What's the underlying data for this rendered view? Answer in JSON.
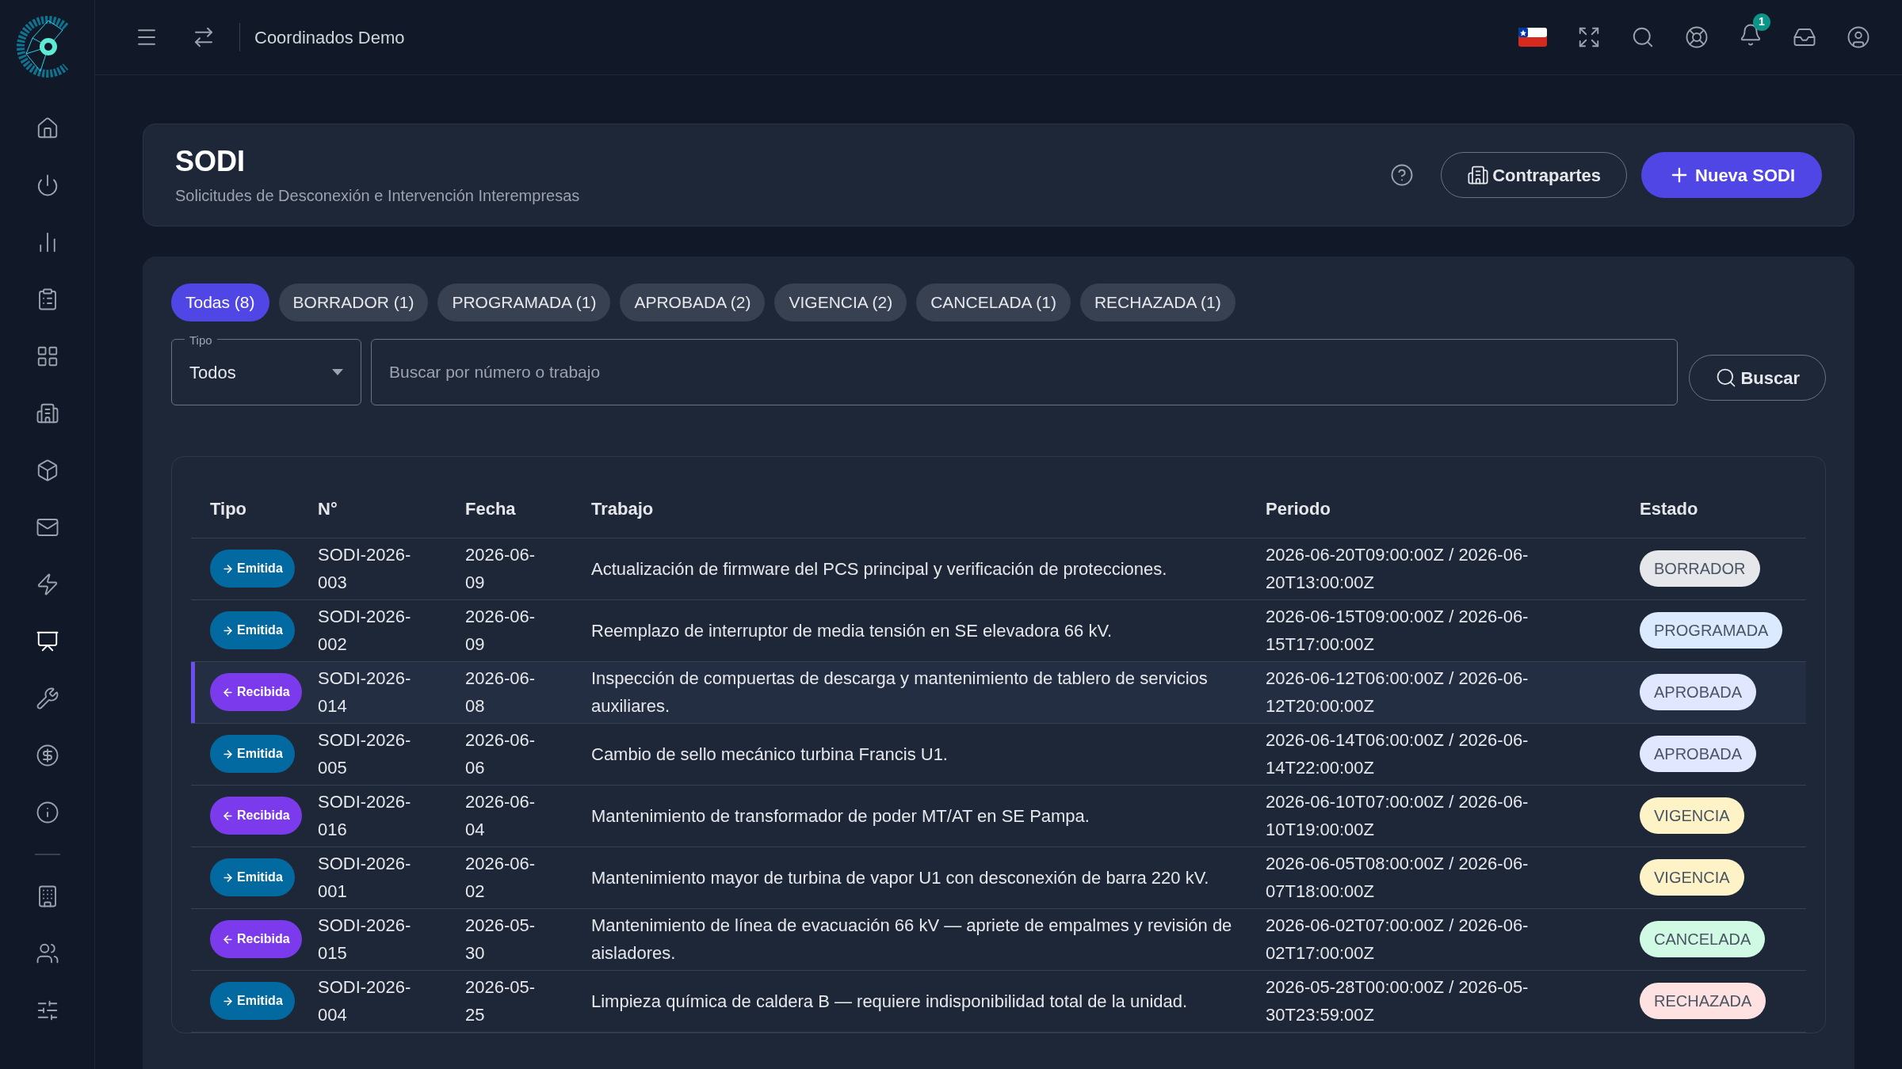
{
  "sidebar": {
    "items": [
      {
        "selected": false
      },
      {
        "selected": false
      },
      {
        "selected": false
      },
      {
        "selected": false
      },
      {
        "selected": false
      },
      {
        "selected": false
      },
      {
        "selected": false
      },
      {
        "selected": false
      },
      {
        "selected": false
      },
      {
        "selected": true
      },
      {
        "selected": false
      },
      {
        "selected": false
      },
      {
        "selected": false
      }
    ],
    "bottom_items": [
      {
        "selected": false
      },
      {
        "selected": false
      },
      {
        "selected": false
      }
    ]
  },
  "topbar": {
    "title": "Coordinados Demo",
    "notification_count": "1"
  },
  "header": {
    "title": "SODI",
    "subtitle": "Solicitudes de Desconexión e Intervención Interempresas",
    "buttons": [
      "Contrapartes",
      "Nueva SODI"
    ]
  },
  "filters": {
    "tabs": [
      {
        "label": "Todas (8)",
        "selected": true
      },
      {
        "label": "BORRADOR (1)",
        "selected": false
      },
      {
        "label": "PROGRAMADA (1)",
        "selected": false
      },
      {
        "label": "APROBADA (2)",
        "selected": false
      },
      {
        "label": "VIGENCIA (2)",
        "selected": false
      },
      {
        "label": "CANCELADA (1)",
        "selected": false
      },
      {
        "label": "RECHAZADA (1)",
        "selected": false
      }
    ],
    "type_select": {
      "label": "Tipo",
      "value": "Todos"
    },
    "search": {
      "placeholder": "Buscar por número o trabajo"
    },
    "search_button": "Buscar"
  },
  "table": {
    "columns": [
      "Tipo",
      "N°",
      "Fecha",
      "Trabajo",
      "Periodo",
      "Estado"
    ],
    "rows": [
      {
        "type": {
          "kind": "emitida",
          "label": "Emitida"
        },
        "number": "SODI-2026-003",
        "date": "2026-06-09",
        "work": "Actualización de firmware del PCS principal y verificación de protecciones.",
        "period": "2026-06-20T09:00:00Z / 2026-06-20T13:00:00Z",
        "status": {
          "label": "BORRADOR",
          "color": "#e5e7eb"
        },
        "selected": false
      },
      {
        "type": {
          "kind": "emitida",
          "label": "Emitida"
        },
        "number": "SODI-2026-002",
        "date": "2026-06-09",
        "work": "Reemplazo de interruptor de media tensión en SE elevadora 66 kV.",
        "period": "2026-06-15T09:00:00Z / 2026-06-15T17:00:00Z",
        "status": {
          "label": "PROGRAMADA",
          "color": "#dbeafe"
        },
        "selected": false
      },
      {
        "type": {
          "kind": "recibida",
          "label": "Recibida"
        },
        "number": "SODI-2026-014",
        "date": "2026-06-08",
        "work": "Inspección de compuertas de descarga y mantenimiento de tablero de servicios auxiliares.",
        "period": "2026-06-12T06:00:00Z / 2026-06-12T20:00:00Z",
        "status": {
          "label": "APROBADA",
          "color": "#e0e7ff"
        },
        "selected": true
      },
      {
        "type": {
          "kind": "emitida",
          "label": "Emitida"
        },
        "number": "SODI-2026-005",
        "date": "2026-06-06",
        "work": "Cambio de sello mecánico turbina Francis U1.",
        "period": "2026-06-14T06:00:00Z / 2026-06-14T22:00:00Z",
        "status": {
          "label": "APROBADA",
          "color": "#e0e7ff"
        },
        "selected": false
      },
      {
        "type": {
          "kind": "recibida",
          "label": "Recibida"
        },
        "number": "SODI-2026-016",
        "date": "2026-06-04",
        "work": "Mantenimiento de transformador de poder MT/AT en SE Pampa.",
        "period": "2026-06-10T07:00:00Z / 2026-06-10T19:00:00Z",
        "status": {
          "label": "VIGENCIA",
          "color": "#fef3c7"
        },
        "selected": false
      },
      {
        "type": {
          "kind": "emitida",
          "label": "Emitida"
        },
        "number": "SODI-2026-001",
        "date": "2026-06-02",
        "work": "Mantenimiento mayor de turbina de vapor U1 con desconexión de barra 220 kV.",
        "period": "2026-06-05T08:00:00Z / 2026-06-07T18:00:00Z",
        "status": {
          "label": "VIGENCIA",
          "color": "#fef3c7"
        },
        "selected": false
      },
      {
        "type": {
          "kind": "recibida",
          "label": "Recibida"
        },
        "number": "SODI-2026-015",
        "date": "2026-05-30",
        "work": "Mantenimiento de línea de evacuación 66 kV — apriete de empalmes y revisión de aisladores.",
        "period": "2026-06-02T07:00:00Z / 2026-06-02T17:00:00Z",
        "status": {
          "label": "CANCELADA",
          "color": "#d1fae5"
        },
        "selected": false
      },
      {
        "type": {
          "kind": "emitida",
          "label": "Emitida"
        },
        "number": "SODI-2026-004",
        "date": "2026-05-25",
        "work": "Limpieza química de caldera B — requiere indisponibilidad total de la unidad.",
        "period": "2026-05-28T00:00:00Z / 2026-05-30T23:59:00Z",
        "status": {
          "label": "RECHAZADA",
          "color": "#fee2e2"
        },
        "selected": false
      }
    ]
  }
}
